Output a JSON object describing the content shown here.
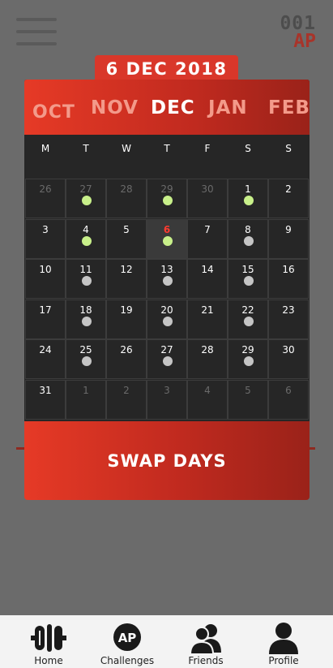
{
  "brand": {
    "number": "001",
    "ap": "AP"
  },
  "selected_date": "6 DEC 2018",
  "months": [
    {
      "label": "OCT",
      "active": false
    },
    {
      "label": "NOV",
      "active": false
    },
    {
      "label": "DEC",
      "active": true
    },
    {
      "label": "JAN",
      "active": false
    },
    {
      "label": "FEB",
      "active": false
    }
  ],
  "weekdays": [
    "M",
    "T",
    "W",
    "T",
    "F",
    "S",
    "S"
  ],
  "weeks": [
    [
      {
        "d": "26",
        "out": true
      },
      {
        "d": "27",
        "out": true,
        "dot": "green"
      },
      {
        "d": "28",
        "out": true
      },
      {
        "d": "29",
        "out": true,
        "dot": "green"
      },
      {
        "d": "30",
        "out": true
      },
      {
        "d": "1",
        "dot": "green"
      },
      {
        "d": "2"
      }
    ],
    [
      {
        "d": "3"
      },
      {
        "d": "4",
        "dot": "green"
      },
      {
        "d": "5"
      },
      {
        "d": "6",
        "today": true,
        "dot": "green"
      },
      {
        "d": "7"
      },
      {
        "d": "8",
        "dot": "grey"
      },
      {
        "d": "9"
      }
    ],
    [
      {
        "d": "10"
      },
      {
        "d": "11",
        "dot": "grey"
      },
      {
        "d": "12"
      },
      {
        "d": "13",
        "dot": "grey"
      },
      {
        "d": "14"
      },
      {
        "d": "15",
        "dot": "grey"
      },
      {
        "d": "16"
      }
    ],
    [
      {
        "d": "17"
      },
      {
        "d": "18",
        "dot": "grey"
      },
      {
        "d": "19"
      },
      {
        "d": "20",
        "dot": "grey"
      },
      {
        "d": "21"
      },
      {
        "d": "22",
        "dot": "grey"
      },
      {
        "d": "23"
      }
    ],
    [
      {
        "d": "24"
      },
      {
        "d": "25",
        "dot": "grey"
      },
      {
        "d": "26"
      },
      {
        "d": "27",
        "dot": "grey"
      },
      {
        "d": "28"
      },
      {
        "d": "29",
        "dot": "grey"
      },
      {
        "d": "30"
      }
    ],
    [
      {
        "d": "31"
      },
      {
        "d": "1",
        "out": true
      },
      {
        "d": "2",
        "out": true
      },
      {
        "d": "3",
        "out": true
      },
      {
        "d": "4",
        "out": true
      },
      {
        "d": "5",
        "out": true
      },
      {
        "d": "6",
        "out": true
      }
    ]
  ],
  "swap_label": "SWAP DAYS",
  "nav": [
    {
      "label": "Home",
      "icon": "dumbbell-icon"
    },
    {
      "label": "Challenges",
      "icon": "ap-badge-icon",
      "badge": "AP"
    },
    {
      "label": "Friends",
      "icon": "friends-icon"
    },
    {
      "label": "Profile",
      "icon": "profile-icon"
    }
  ],
  "colors": {
    "accent": "#d9372a",
    "green_dot": "#c8f08a",
    "grey_dot": "#c5c5c5"
  }
}
